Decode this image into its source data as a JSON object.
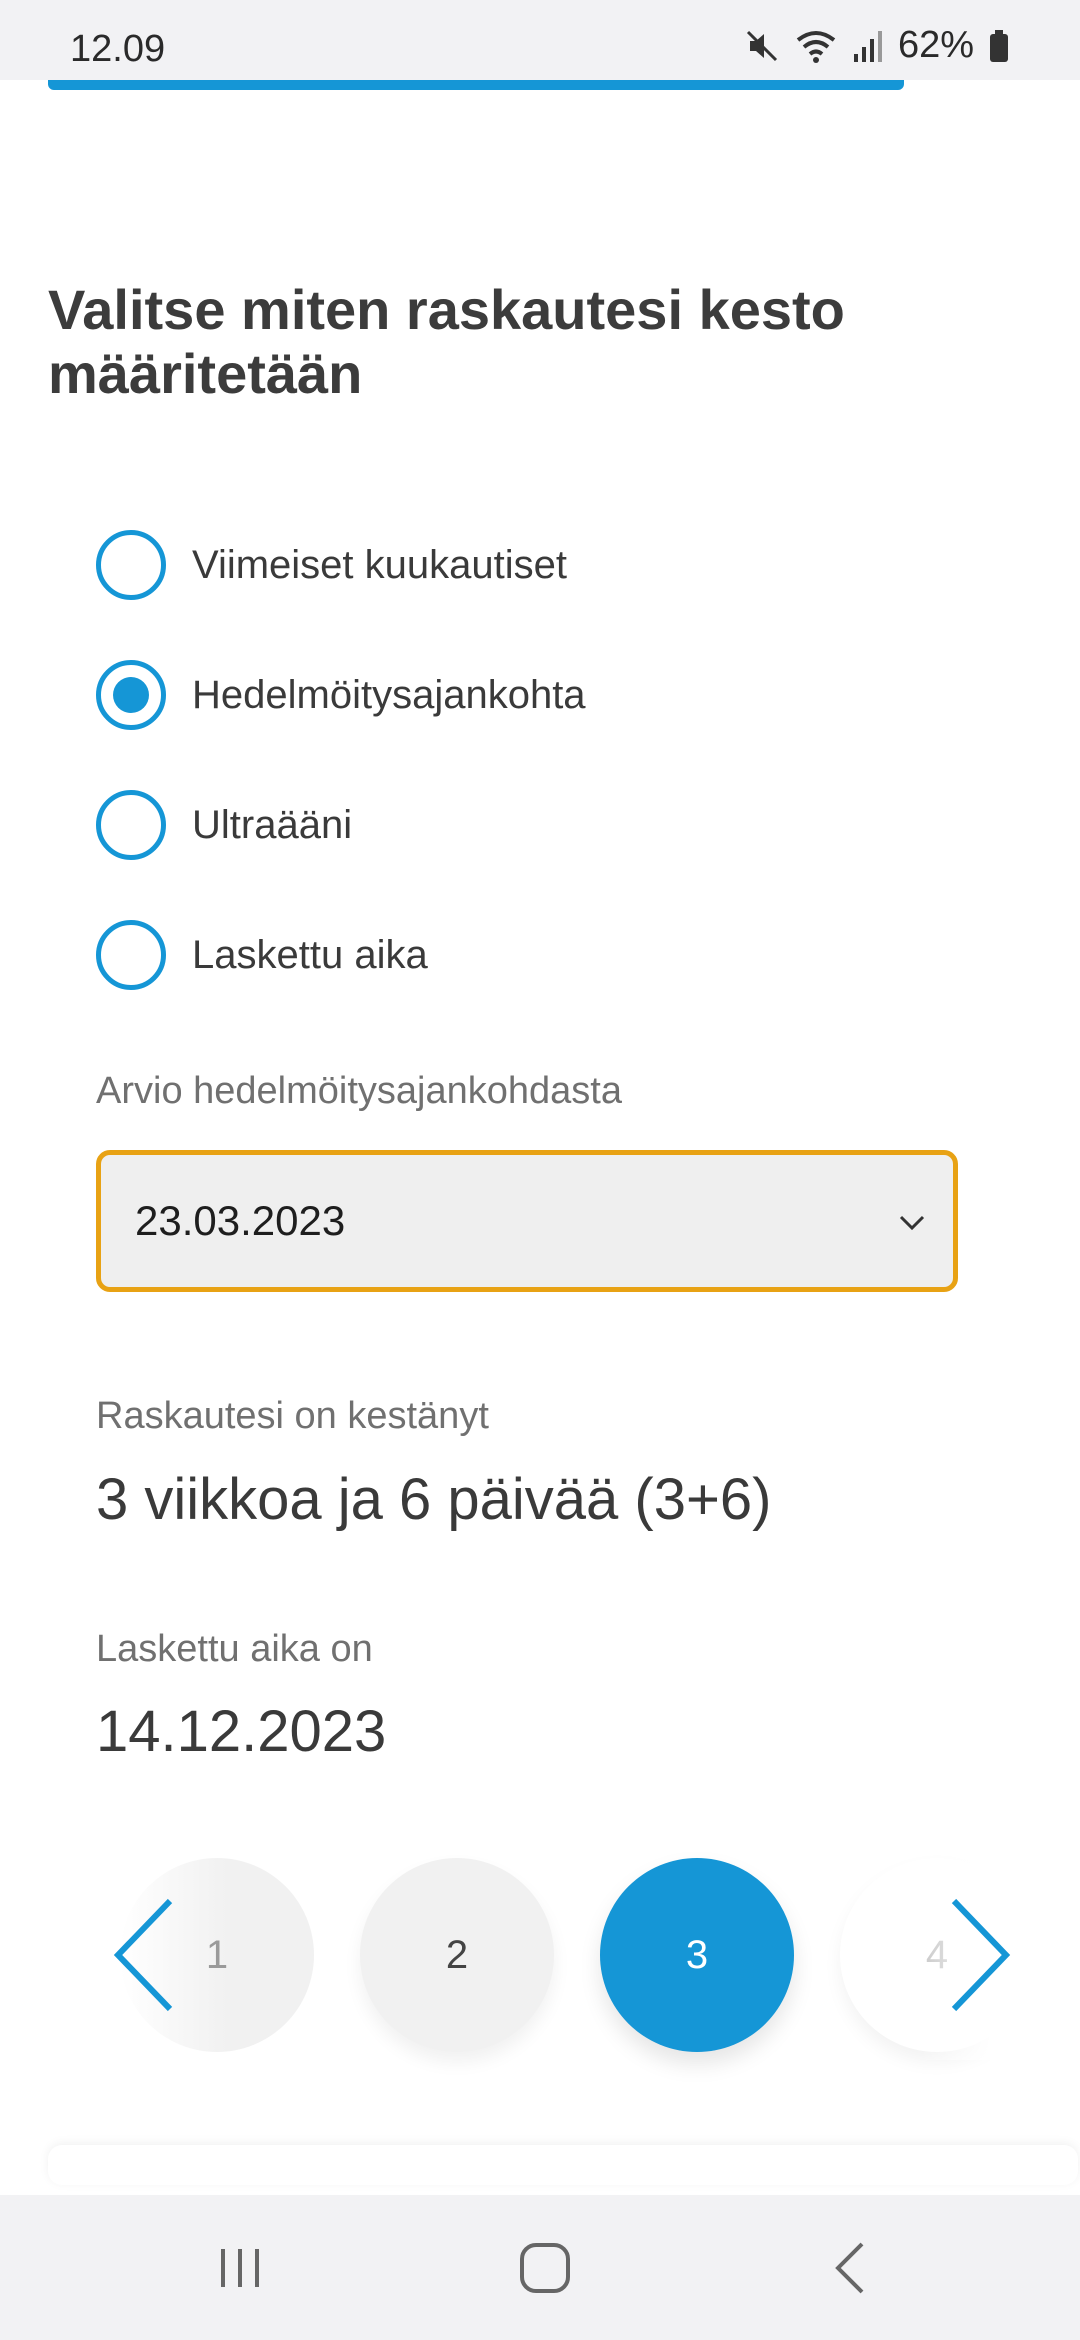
{
  "status": {
    "time": "12.09",
    "battery": "62%"
  },
  "title": "Valitse miten raskautesi kesto määritetään",
  "options": [
    {
      "label": "Viimeiset kuukautiset",
      "checked": false
    },
    {
      "label": "Hedelmöitysajankohta",
      "checked": true
    },
    {
      "label": "Ultraääni",
      "checked": false
    },
    {
      "label": "Laskettu aika",
      "checked": false
    }
  ],
  "date_field": {
    "label": "Arvio hedelmöitysajankohdasta",
    "value": "23.03.2023"
  },
  "duration": {
    "label": "Raskautesi on kestänyt",
    "value": "3 viikkoa ja 6 päivää (3+6)"
  },
  "due_date": {
    "label": "Laskettu aika on",
    "value": "14.12.2023"
  },
  "steps": {
    "items": [
      "1",
      "2",
      "3",
      "4"
    ],
    "current": "3"
  },
  "colors": {
    "accent": "#1596d6",
    "focus_border": "#e8a214"
  }
}
